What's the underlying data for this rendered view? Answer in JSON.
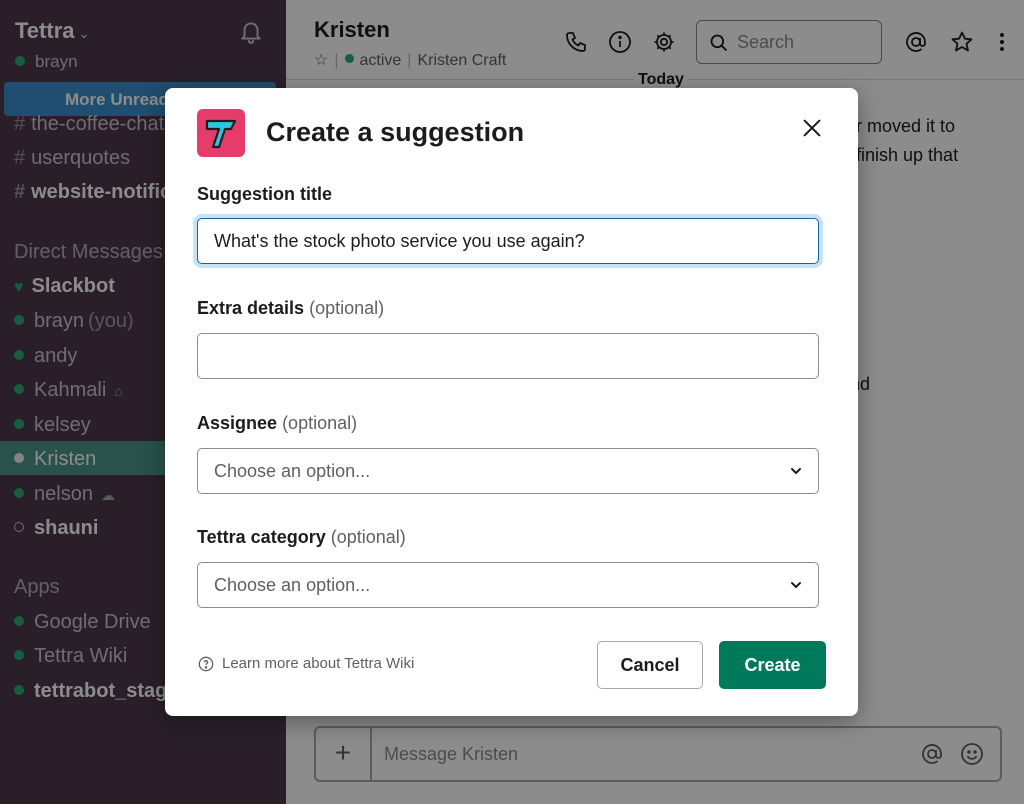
{
  "sidebar": {
    "workspace": "Tettra",
    "user": "brayn",
    "more_unreads": "More Unreads",
    "channels": [
      "the-coffee-chat",
      "userquotes",
      "website-notifications"
    ],
    "dm_heading": "Direct Messages",
    "dms": [
      {
        "name": "Slackbot"
      },
      {
        "name": "brayn",
        "suffix": "(you)"
      },
      {
        "name": "andy"
      },
      {
        "name": "Kahmali"
      },
      {
        "name": "kelsey"
      },
      {
        "name": "Kristen"
      },
      {
        "name": "nelson"
      },
      {
        "name": "shauni"
      }
    ],
    "apps_heading": "Apps",
    "apps": [
      "Google Drive",
      "Tettra Wiki",
      "tettrabot_staging"
    ]
  },
  "header": {
    "channel_title": "Kristen",
    "status": "active",
    "full_name": "Kristen Craft",
    "search_placeholder": "Search",
    "day_divider": "Today"
  },
  "messages_fragments": [
    "or moved it to",
    "I finish up that",
    "ind"
  ],
  "composer": {
    "placeholder": "Message Kristen"
  },
  "modal": {
    "title": "Create a suggestion",
    "suggestion_title_label": "Suggestion title",
    "suggestion_title_value": "What's the stock photo service you use again?",
    "extra_details_label": "Extra details",
    "assignee_label": "Assignee",
    "category_label": "Tettra category",
    "optional": "(optional)",
    "choose_option": "Choose an option...",
    "learn_more": "Learn more about Tettra Wiki",
    "cancel": "Cancel",
    "create": "Create"
  },
  "colors": {
    "sidebar_bg": "#4d394b",
    "presence_green": "#2bac76",
    "primary_button": "#007a5a",
    "logo_pink": "#e63c6b",
    "logo_cyan": "#2fc4e4"
  }
}
